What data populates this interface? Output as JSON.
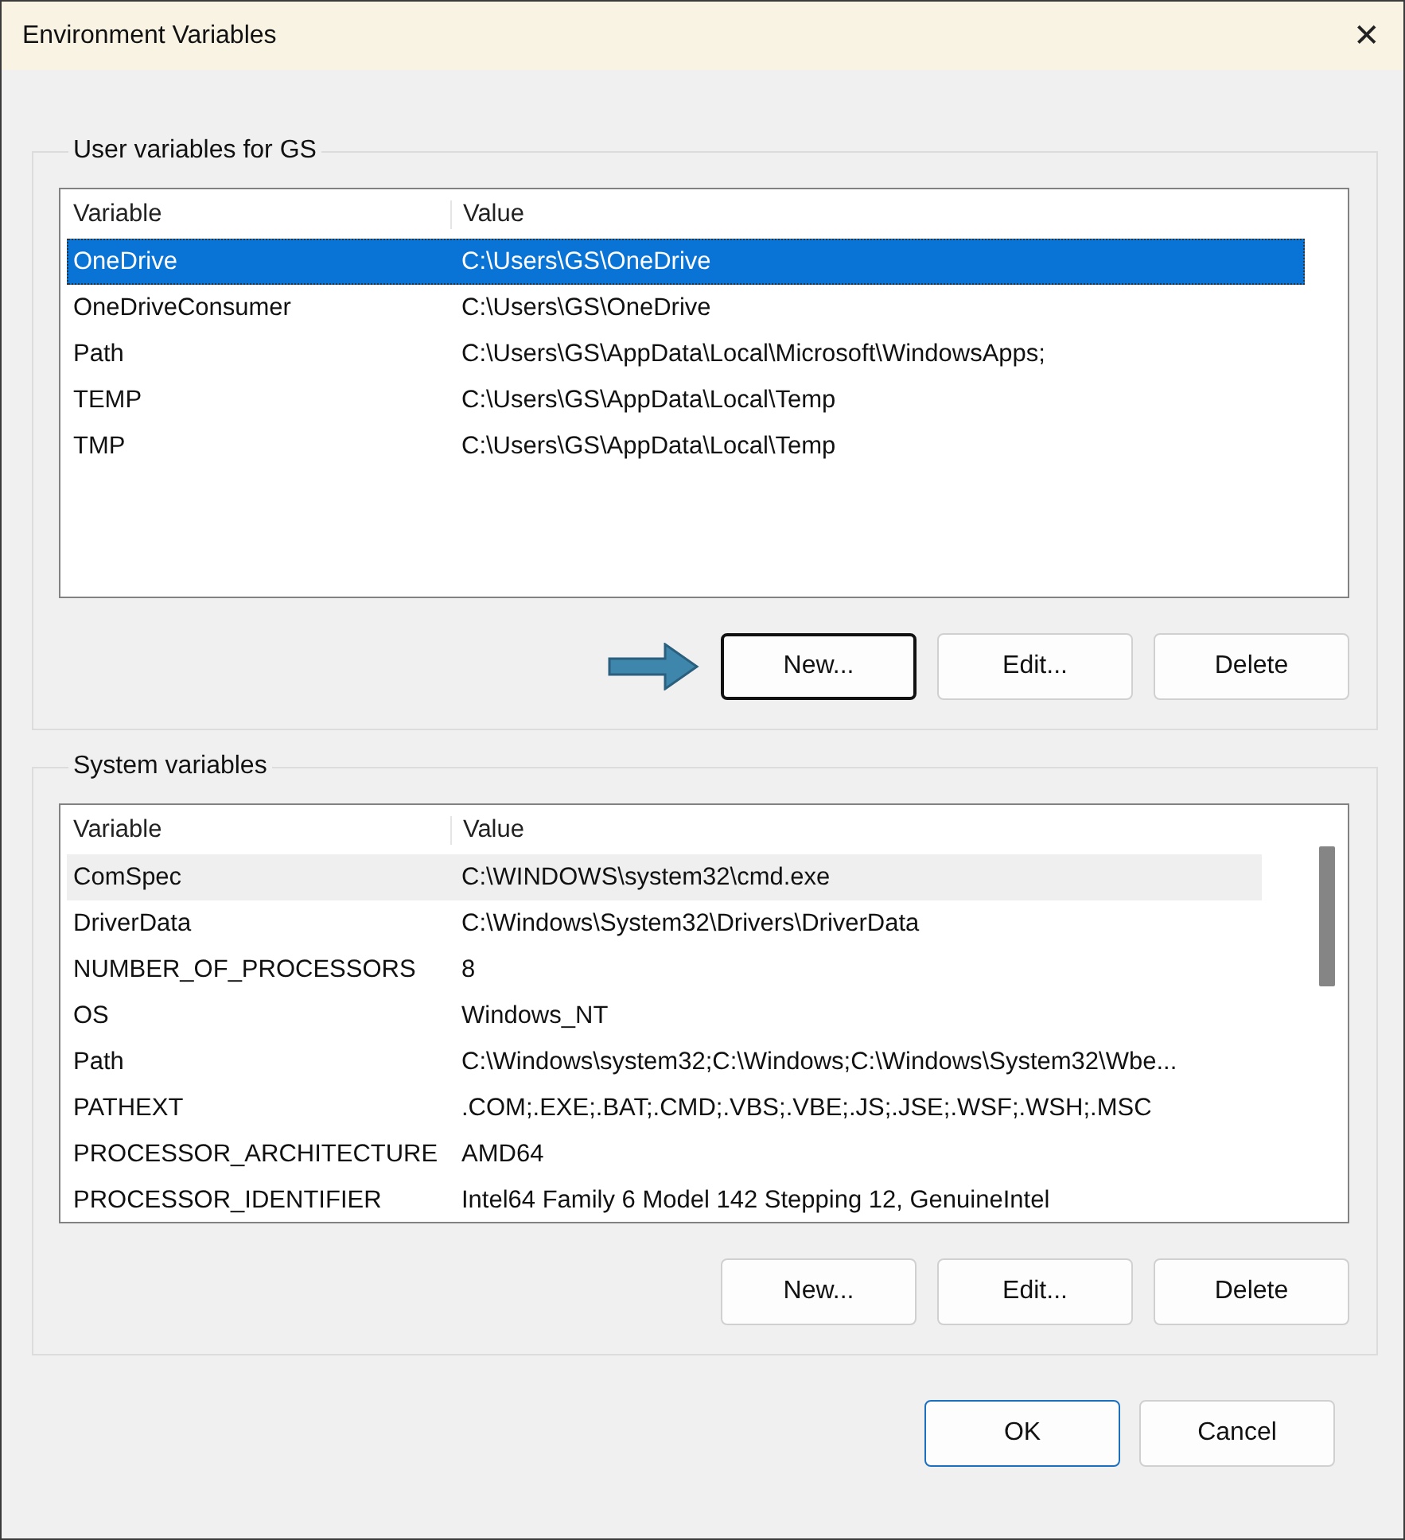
{
  "window": {
    "title": "Environment Variables",
    "close": "✕"
  },
  "sections": [
    {
      "title": "User variables for GS",
      "focused": true,
      "columns": [
        "Variable",
        "Value"
      ],
      "scrollbar": false,
      "rows": [
        {
          "variable": "OneDrive",
          "value": "C:\\Users\\GS\\OneDrive",
          "selected": true
        },
        {
          "variable": "OneDriveConsumer",
          "value": "C:\\Users\\GS\\OneDrive",
          "selected": false
        },
        {
          "variable": "Path",
          "value": "C:\\Users\\GS\\AppData\\Local\\Microsoft\\WindowsApps;",
          "selected": false
        },
        {
          "variable": "TEMP",
          "value": "C:\\Users\\GS\\AppData\\Local\\Temp",
          "selected": false
        },
        {
          "variable": "TMP",
          "value": "C:\\Users\\GS\\AppData\\Local\\Temp",
          "selected": false
        }
      ],
      "buttons": [
        {
          "label": "New...",
          "focused": true
        },
        {
          "label": "Edit...",
          "focused": false
        },
        {
          "label": "Delete",
          "focused": false
        }
      ],
      "pointer_arrow": true
    },
    {
      "title": "System variables",
      "focused": false,
      "columns": [
        "Variable",
        "Value"
      ],
      "scrollbar": true,
      "rows": [
        {
          "variable": "ComSpec",
          "value": "C:\\WINDOWS\\system32\\cmd.exe",
          "selected": true
        },
        {
          "variable": "DriverData",
          "value": "C:\\Windows\\System32\\Drivers\\DriverData",
          "selected": false
        },
        {
          "variable": "NUMBER_OF_PROCESSORS",
          "value": "8",
          "selected": false
        },
        {
          "variable": "OS",
          "value": "Windows_NT",
          "selected": false
        },
        {
          "variable": "Path",
          "value": "C:\\Windows\\system32;C:\\Windows;C:\\Windows\\System32\\Wbe...",
          "selected": false
        },
        {
          "variable": "PATHEXT",
          "value": ".COM;.EXE;.BAT;.CMD;.VBS;.VBE;.JS;.JSE;.WSF;.WSH;.MSC",
          "selected": false
        },
        {
          "variable": "PROCESSOR_ARCHITECTURE",
          "value": "AMD64",
          "selected": false
        },
        {
          "variable": "PROCESSOR_IDENTIFIER",
          "value": "Intel64 Family 6 Model 142 Stepping 12, GenuineIntel",
          "selected": false
        }
      ],
      "buttons": [
        {
          "label": "New...",
          "focused": false
        },
        {
          "label": "Edit...",
          "focused": false
        },
        {
          "label": "Delete",
          "focused": false
        }
      ],
      "pointer_arrow": false
    }
  ],
  "footer_buttons": [
    {
      "label": "OK",
      "default": true
    },
    {
      "label": "Cancel",
      "default": false
    }
  ]
}
